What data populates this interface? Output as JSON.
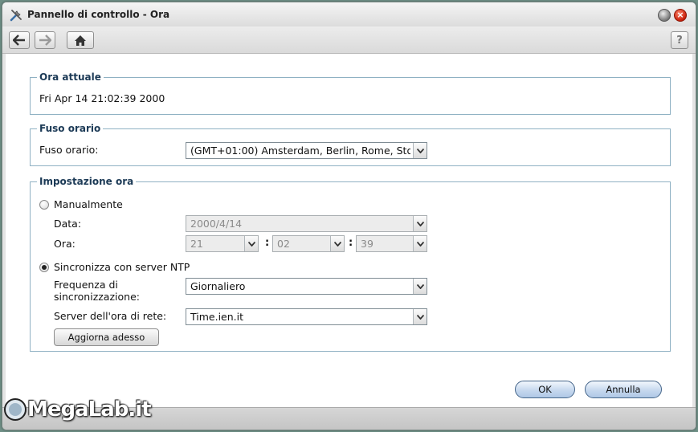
{
  "window": {
    "title": "Pannello di controllo - Ora"
  },
  "toolbar": {
    "help_label": "?"
  },
  "ora_attuale": {
    "legend": "Ora attuale",
    "value": "Fri Apr 14 21:02:39 2000"
  },
  "fuso_orario": {
    "legend": "Fuso orario",
    "label": "Fuso orario:",
    "value": "(GMT+01:00) Amsterdam, Berlin, Rome, Stoc"
  },
  "impostazione_ora": {
    "legend": "Impostazione ora",
    "manual_label": "Manualmente",
    "data_label": "Data:",
    "data_value": "2000/4/14",
    "ora_label": "Ora:",
    "hour": "21",
    "minute": "02",
    "second": "39",
    "colon": ":",
    "ntp_label": "Sincronizza con server NTP",
    "freq_label_1": "Frequenza di",
    "freq_label_2": "sincronizzazione:",
    "freq_value": "Giornaliero",
    "server_label": "Server dell'ora di rete:",
    "server_value": "Time.ien.it",
    "update_button": "Aggiorna adesso",
    "selected_mode": "ntp"
  },
  "footer": {
    "ok_label": "OK",
    "cancel_label": "Annulla"
  },
  "watermark": {
    "text": "MegaLab.it"
  }
}
